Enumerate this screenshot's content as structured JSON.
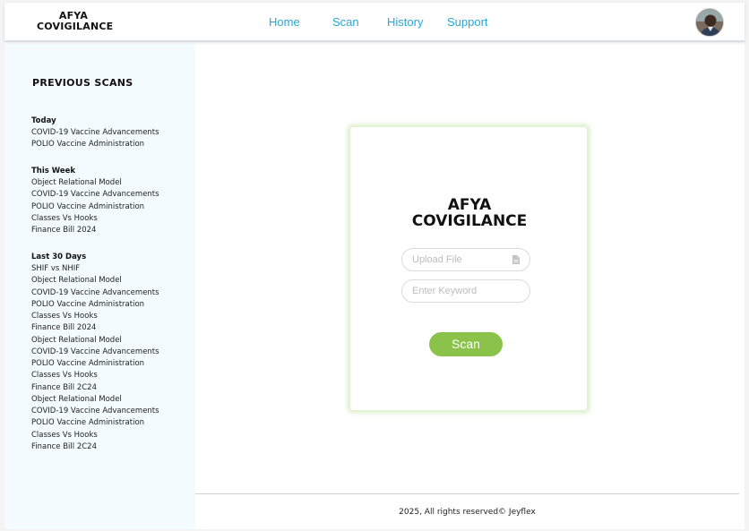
{
  "header": {
    "logo_line1": "AFYA",
    "logo_line2": "COVIGILANCE",
    "nav": {
      "home": "Home",
      "scan": "Scan",
      "history": "History",
      "support": "Support"
    },
    "avatar_icon": "user-avatar-icon"
  },
  "sidebar": {
    "title": "PREVIOUS SCANS",
    "groups": [
      {
        "title": "Today",
        "items": [
          "COVID-19 Vaccine Advancements",
          "POLIO Vaccine Administration"
        ]
      },
      {
        "title": "This Week",
        "items": [
          "Object Relational Model",
          "COVID-19 Vaccine Advancements",
          "POLIO Vaccine Administration",
          "Classes Vs Hooks",
          "Finance Bill 2024"
        ]
      },
      {
        "title": "Last 30 Days",
        "items": [
          "SHIF vs NHIF",
          "Object Relational Model",
          "COVID-19 Vaccine Advancements",
          "POLIO Vaccine Administration",
          "Classes Vs Hooks",
          "Finance Bill 2024",
          "Object Relational Model",
          "COVID-19 Vaccine Advancements",
          "POLIO Vaccine Administration",
          "Classes Vs Hooks",
          "Finance Bill 2C24",
          "Object Relational Model",
          "COVID-19 Vaccine Advancements",
          "POLIO Vaccine Administration",
          "Classes Vs Hooks",
          "Finance Bill 2C24"
        ]
      }
    ]
  },
  "card": {
    "title_line1": "AFYA",
    "title_line2": "COVIGILANCE",
    "upload": {
      "placeholder": "Upload File",
      "icon": "file-icon"
    },
    "keyword": {
      "placeholder": "Enter Keyword"
    },
    "scan_label": "Scan"
  },
  "footer": {
    "text": "2025, All rights reserved© Jeyflex"
  },
  "colors": {
    "accent": "#8bc34a",
    "nav_link": "#2aa7d6",
    "sidebar_bg": "#f3fbfe"
  }
}
